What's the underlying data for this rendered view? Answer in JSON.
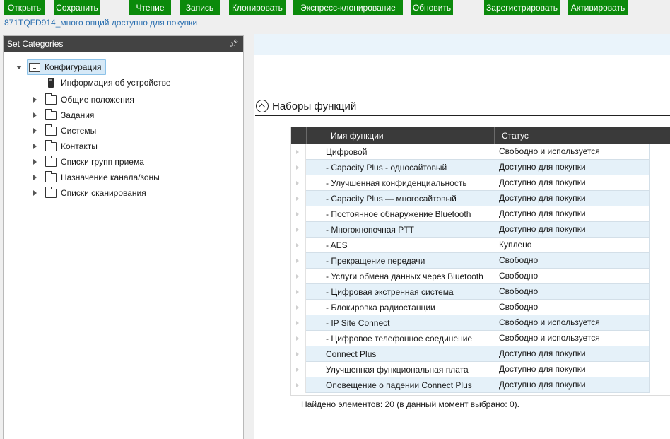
{
  "toolbar": {
    "open": "Открыть",
    "save": "Сохранить",
    "read": "Чтение",
    "write": "Запись",
    "clone": "Клонировать",
    "express_clone": "Экспресс-клонирование",
    "update": "Обновить",
    "register": "Зарегистрировать",
    "activate": "Активировать"
  },
  "device_info": "871TQFD914_много опций доступно для покупки",
  "left_panel": {
    "title": "Set Categories",
    "pin_icon": "pin-icon",
    "root": {
      "label": "Конфигурация",
      "expanded": true
    },
    "device_item": {
      "label": "Информация об устройстве"
    },
    "folders": [
      {
        "label": "Общие положения"
      },
      {
        "label": "Задания"
      },
      {
        "label": "Системы"
      },
      {
        "label": "Контакты"
      },
      {
        "label": "Списки групп приема"
      },
      {
        "label": "Назначение канала/зоны"
      },
      {
        "label": "Списки сканирования"
      }
    ]
  },
  "feature_sets": {
    "title": "Наборы функций",
    "columns": {
      "name": "Имя функции",
      "status": "Статус"
    },
    "rows": [
      {
        "name": "Цифровой",
        "status": "Свободно и используется"
      },
      {
        "name": "- Capacity Plus - односайтовый",
        "status": "Доступно для покупки"
      },
      {
        "name": "- Улучшенная конфиденциальность",
        "status": "Доступно для покупки"
      },
      {
        "name": "- Capacity Plus — многосайтовый",
        "status": "Доступно для покупки"
      },
      {
        "name": "- Постоянное обнаружение Bluetooth",
        "status": "Доступно для покупки"
      },
      {
        "name": "- Многокнопочная PTT",
        "status": "Доступно для покупки"
      },
      {
        "name": "- AES",
        "status": "Куплено"
      },
      {
        "name": "- Прекращение передачи",
        "status": "Свободно"
      },
      {
        "name": "- Услуги обмена данных через Bluetooth",
        "status": "Свободно"
      },
      {
        "name": "- Цифровая экстренная система",
        "status": "Свободно"
      },
      {
        "name": "- Блокировка радиостанции",
        "status": "Свободно"
      },
      {
        "name": "- IP Site Connect",
        "status": "Свободно и используется"
      },
      {
        "name": "- Цифровое телефонное соединение",
        "status": "Свободно и используется"
      },
      {
        "name": "Connect Plus",
        "status": "Доступно для покупки"
      },
      {
        "name": "Улучшенная функциональная плата",
        "status": "Доступно для покупки"
      },
      {
        "name": "Оповещение о падении Connect Plus",
        "status": "Доступно для покупки"
      }
    ],
    "footer": "Найдено элементов: 20 (в данный момент выбрано: 0)."
  },
  "colors": {
    "toolbar_green": "#0b8a0b",
    "header_dark": "#434343",
    "link_blue": "#2a6fb0",
    "row_alt": "#e5f1f9",
    "selection": "#d6e9f7"
  }
}
